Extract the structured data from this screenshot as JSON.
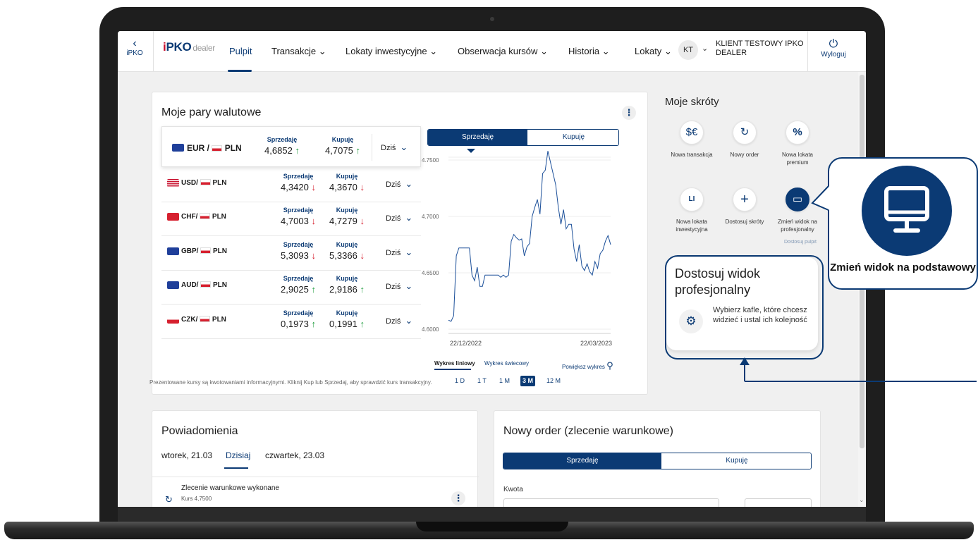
{
  "nav": {
    "back_label": "iPKO",
    "logo_main": "PKO",
    "logo_i": "i",
    "logo_dealer": "dealer",
    "items": [
      "Pulpit",
      "Transakcje",
      "Lokaty inwestycyjne",
      "Obserwacja kursów",
      "Historia",
      "Lokaty"
    ],
    "avatar": "KT",
    "client_name": "KLIENT TESTOWY IPKO DEALER",
    "logout": "Wyloguj"
  },
  "pairs_card": {
    "title": "Moje pary walutowe",
    "sell_label": "Sprzedaję",
    "buy_label": "Kupuję",
    "period": "Dziś",
    "rows": [
      {
        "base": "EUR",
        "quote": "PLN",
        "sell": "4,6852",
        "sell_dir": "↑",
        "buy": "4,7075",
        "buy_dir": "↑"
      },
      {
        "base": "USD",
        "quote": "PLN",
        "sell": "4,3420",
        "sell_dir": "↓",
        "buy": "4,3670",
        "buy_dir": "↓"
      },
      {
        "base": "CHF",
        "quote": "PLN",
        "sell": "4,7003",
        "sell_dir": "↓",
        "buy": "4,7279",
        "buy_dir": "↓"
      },
      {
        "base": "GBP",
        "quote": "PLN",
        "sell": "5,3093",
        "sell_dir": "↓",
        "buy": "5,3366",
        "buy_dir": "↓"
      },
      {
        "base": "AUD",
        "quote": "PLN",
        "sell": "2,9025",
        "sell_dir": "↑",
        "buy": "2,9186",
        "buy_dir": "↑"
      },
      {
        "base": "CZK",
        "quote": "PLN",
        "sell": "0,1973",
        "sell_dir": "↑",
        "buy": "0,1991",
        "buy_dir": "↑"
      }
    ],
    "footnote": "Prezentowane kursy są kwotowaniami informacyjnymi. Kliknij Kup lub Sprzedaj, aby sprawdzić kurs transakcyjny.",
    "chart_toggle": [
      "Sprzedaję",
      "Kupuję"
    ],
    "chart_types": [
      "Wykres liniowy",
      "Wykres świecowy"
    ],
    "zoom_label": "Powiększ wykres",
    "ranges": [
      "1 D",
      "1 T",
      "1 M",
      "3 M",
      "12 M"
    ],
    "selected_range": "3 M"
  },
  "chart_data": {
    "type": "line",
    "title": "",
    "xlabel": "",
    "ylabel": "",
    "x_ticks": [
      "22/12/2022",
      "22/03/2023"
    ],
    "y_ticks": [
      "4.7500",
      "4.7000",
      "4.6500",
      "4.6000"
    ],
    "ylim": [
      4.6,
      4.75
    ],
    "x_index": [
      0,
      1,
      2,
      3,
      4,
      5,
      6,
      7,
      8,
      9,
      10,
      11,
      12,
      13,
      14,
      15,
      16,
      17,
      18,
      19,
      20,
      21,
      22,
      23,
      24,
      25,
      26,
      27,
      28,
      29,
      30,
      31,
      32,
      33,
      34,
      35,
      36,
      37,
      38,
      39,
      40,
      41,
      42,
      43,
      44,
      45,
      46,
      47,
      48,
      49,
      50,
      51,
      52,
      53,
      54,
      55,
      56,
      57,
      58,
      59,
      60,
      61,
      62
    ],
    "series": [
      {
        "values": [
          4.608,
          4.607,
          4.612,
          4.665,
          4.672,
          4.672,
          4.672,
          4.672,
          4.672,
          4.648,
          4.643,
          4.655,
          4.638,
          4.638,
          4.648,
          4.648,
          4.648,
          4.648,
          4.648,
          4.648,
          4.646,
          4.648,
          4.646,
          4.648,
          4.678,
          4.684,
          4.681,
          4.679,
          4.68,
          4.665,
          4.673,
          4.676,
          4.7,
          4.708,
          4.715,
          4.702,
          4.738,
          4.741,
          4.758,
          4.748,
          4.738,
          4.728,
          4.708,
          4.693,
          4.706,
          4.689,
          4.693,
          4.693,
          4.671,
          4.66,
          4.675,
          4.656,
          4.652,
          4.658,
          4.651,
          4.648,
          4.66,
          4.654,
          4.667,
          4.67,
          4.678,
          4.683,
          4.675
        ]
      }
    ],
    "grid": true
  },
  "shortcuts": {
    "title": "Moje skróty",
    "items": [
      {
        "label": "Nowa transakcja",
        "icon": "exchange-icon"
      },
      {
        "label": "Nowy order",
        "icon": "refresh-order-icon"
      },
      {
        "label": "Nowa lokata premium",
        "icon": "percent-star-icon"
      },
      {
        "label": "Nowa lokata inwestycyjna",
        "icon": "li-icon"
      },
      {
        "label": "Dostosuj skróty",
        "icon": "plus-icon"
      },
      {
        "label": "Zmień widok na profesjonalny",
        "icon": "monitor-icon"
      }
    ],
    "hidden_link": "Dostosuj pulpit"
  },
  "customize": {
    "title": "Dostosuj widok profesjonalny",
    "text": "Wybierz kafle, które chcesz widzieć i ustal ich kolejność"
  },
  "callout": {
    "text": "Zmień widok na podstawowy"
  },
  "notifications": {
    "title": "Powiadomienia",
    "tabs": [
      "wtorek, 21.03",
      "Dzisiaj",
      "czwartek, 23.03"
    ],
    "item_title": "Zlecenie warunkowe wykonane",
    "item_sub": "Kurs 4,7500"
  },
  "order": {
    "title": "Nowy order (zlecenie warunkowe)",
    "toggle": [
      "Sprzedaję",
      "Kupuję"
    ],
    "amount_label": "Kwota"
  },
  "colors": {
    "brand": "#0b3a74",
    "up": "#1e9c3c",
    "down": "#d6202f"
  }
}
